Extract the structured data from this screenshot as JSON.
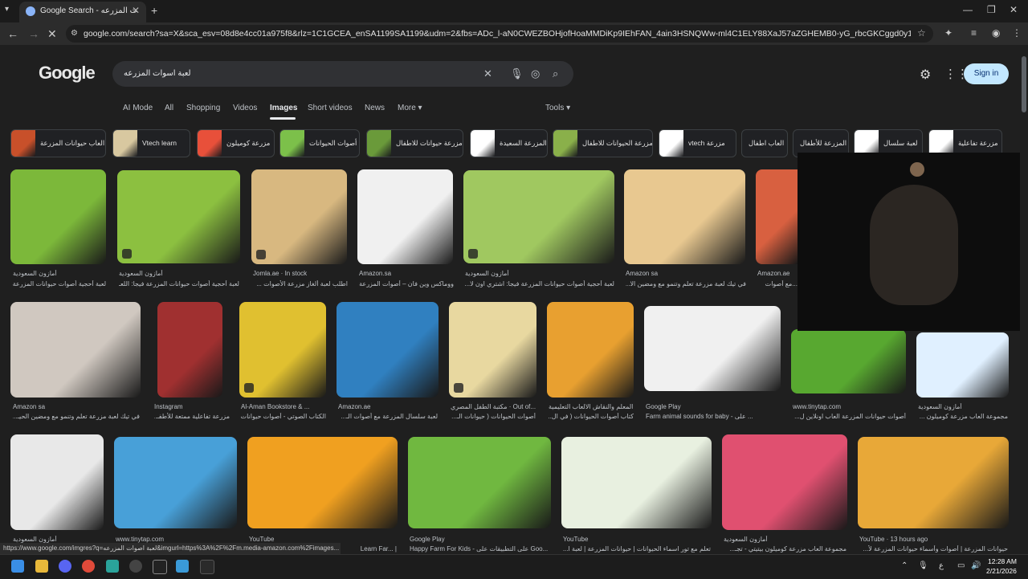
{
  "browser": {
    "tab_title": "Google Search - لعبة أصوات المزرعه",
    "url": "google.com/search?sa=X&sca_esv=08d8e4cc01a975f8&rlz=1C1GCEA_enSA1199SA1199&udm=2&fbs=ADc_l-aN0CWEZBOHjofHoaMMDiKp9IEhFAN_4ain3HSNQWw-ml4C1ELY88XaJ57aZGHEMB0-yG_rbcGKCggd0y127_8yRR2oZvo9JRZhfXpTeygFz5r..."
  },
  "google": {
    "logo": "Google",
    "query": "لعبة اسوات المزرعه",
    "signin": "Sign in",
    "nav": [
      "AI Mode",
      "All",
      "Shopping",
      "Videos",
      "Images",
      "Short videos",
      "News",
      "More ▾"
    ],
    "tools": "Tools ▾"
  },
  "chips": [
    {
      "label": "العاب حيوانات المزرعة",
      "color": "#c8502a"
    },
    {
      "label": "Vtech learn",
      "color": "#d8c8a0"
    },
    {
      "label": "مزرعة كوميلون",
      "color": "#e8503a"
    },
    {
      "label": "أصوات الحيوانات",
      "color": "#7cc04a"
    },
    {
      "label": "مزرعة حيوانات للاطفال",
      "color": "#6a9a3a"
    },
    {
      "label": "المزرعة السعيدة",
      "color": "#ffffff"
    },
    {
      "label": "مزرعة الحيوانات للاطفال",
      "color": "#8ab04a"
    },
    {
      "label": "vtech مزرعة",
      "color": "#ffffff"
    },
    {
      "label": "العاب اطفال",
      "color": "#202124"
    },
    {
      "label": "المزرعة للأطفال",
      "color": "#202124"
    },
    {
      "label": "لعبة سلسال",
      "color": "#ffffff"
    },
    {
      "label": "مزرعة تفاعلية",
      "color": "#ffffff"
    }
  ],
  "results_row1": [
    {
      "src": "أمازون السعودية",
      "cap": "لعبة أحجية أصوات حيوانات المزرعة...",
      "color": "#7cb83a"
    },
    {
      "src": "أمازون السعودية",
      "cap": "لعبة أحجية أصوات حيوانات المزرعة فيجا: اللعـ...",
      "color": "#8cc040"
    },
    {
      "src": "Jomla.ae · In stock",
      "cap": "اطلب لعبة ألغاز مزرعة الأصوات ...",
      "color": "#d8b880"
    },
    {
      "src": "Amazon.sa",
      "cap": "ووماكس وين فان – أصوات المزرعة ...",
      "color": "#f0f0f0"
    },
    {
      "src": "أمازون السعودية",
      "cap": "لعبة أحجية أصوات حيوانات المزرعة فيجا: اشتري اون لا...",
      "color": "#a0c860"
    },
    {
      "src": "Amazon sa",
      "cap": "في تيك لعبة مزرعة تعلم وتنمو مع ومضين الا...",
      "color": "#e8c890"
    },
    {
      "src": "Amazon.ae",
      "cap": "...مع أصوات",
      "color": "#d86040"
    }
  ],
  "results_row2": [
    {
      "src": "Amazon sa",
      "cap": "في تيك لعبة مزرعة تعلم وتنمو مع ومضين الحيـ...",
      "color": "#d0c8c0"
    },
    {
      "src": "Instagram",
      "cap": "مزرعة تفاعلية ممتعة للأطفـ...",
      "color": "#a03030"
    },
    {
      "src": "Al-Aman Bookstore & ...",
      "cap": "الكتاب الصوتي - أصوات حيوانات ...",
      "color": "#e0c030"
    },
    {
      "src": "Amazon.ae",
      "cap": "لعبة سلسال المزرعة مع أصوات الـ...",
      "color": "#3080c0"
    },
    {
      "src": "مكتبة الطفل المصري · Out of...",
      "cap": "أصوات الحيوانات ( حيوانات الـ...",
      "color": "#e8d8a0"
    },
    {
      "src": "المعلم والنقاش الالعاب التعليمية",
      "cap": "كتاب أصوات الحيوانات ( في ال...",
      "color": "#e8a030"
    },
    {
      "src": "Google Play",
      "cap": "Farm animal sounds for baby - على ...",
      "color": "#f0f0f0"
    },
    {
      "src": "www.tinytap.com",
      "cap": "أصوات حيوانات المزرعة العاب اونلاين ل...",
      "color": "#58a830"
    },
    {
      "src": "أمازون السعودية",
      "cap": "مجموعة العاب مزرعة كوميلون ...",
      "color": "#e0f0ff"
    }
  ],
  "results_row3": [
    {
      "src": "أمازون السعودية",
      "cap": "",
      "color": "#e8e8e8"
    },
    {
      "src": "www.tinytap.com",
      "cap": "",
      "color": "#48a0d8"
    },
    {
      "src": "YouTube",
      "cap": "Learn Far... |",
      "color": "#f0a020"
    },
    {
      "src": "Google Play",
      "cap": "Happy Farm For Kids - على التطبيقات على Goo...",
      "color": "#70b840"
    },
    {
      "src": "YouTube",
      "cap": "تعلم مع تور اسماء الحيوانات | حيوانات المزرعة | لعبة ا...",
      "color": "#e8f0e0"
    },
    {
      "src": "أمازون السعودية",
      "cap": "مجموعة العاب مزرعة كوميلون بيتيتي - تجـ...",
      "color": "#e05070"
    },
    {
      "src": "YouTube · 13 hours ago",
      "cap": "حيوانات المزرعة | أصوات وأسماء حيوانات المزرعة لأ...",
      "color": "#e8a838"
    }
  ],
  "status_url": "https://www.google.com/imgres?q=لعبة اصوات المزرعه&imgurl=https%3A%2F%2Fm.media-amazon.com%2Fimages...",
  "clock": {
    "time": "12:28 AM",
    "date": "2/21/2026"
  }
}
